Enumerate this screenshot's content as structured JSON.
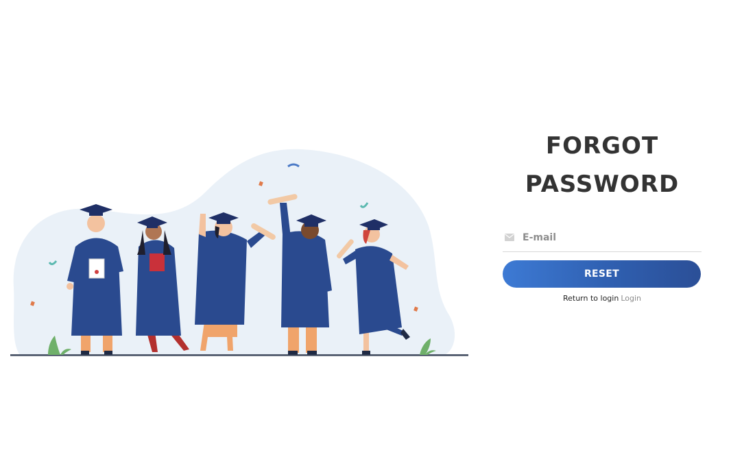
{
  "form": {
    "title_line1": "FORGOT",
    "title_line2": "PASSWORD",
    "email_placeholder": "E-mail",
    "reset_label": "RESET",
    "return_text": "Return to login",
    "login_link": "Login"
  },
  "icons": {
    "email": "mail-icon"
  },
  "colors": {
    "button_start": "#3d7ad4",
    "button_end": "#2b4f97",
    "title": "#333333",
    "gown": "#2a4a8f",
    "blob": "#eaf1f8"
  }
}
